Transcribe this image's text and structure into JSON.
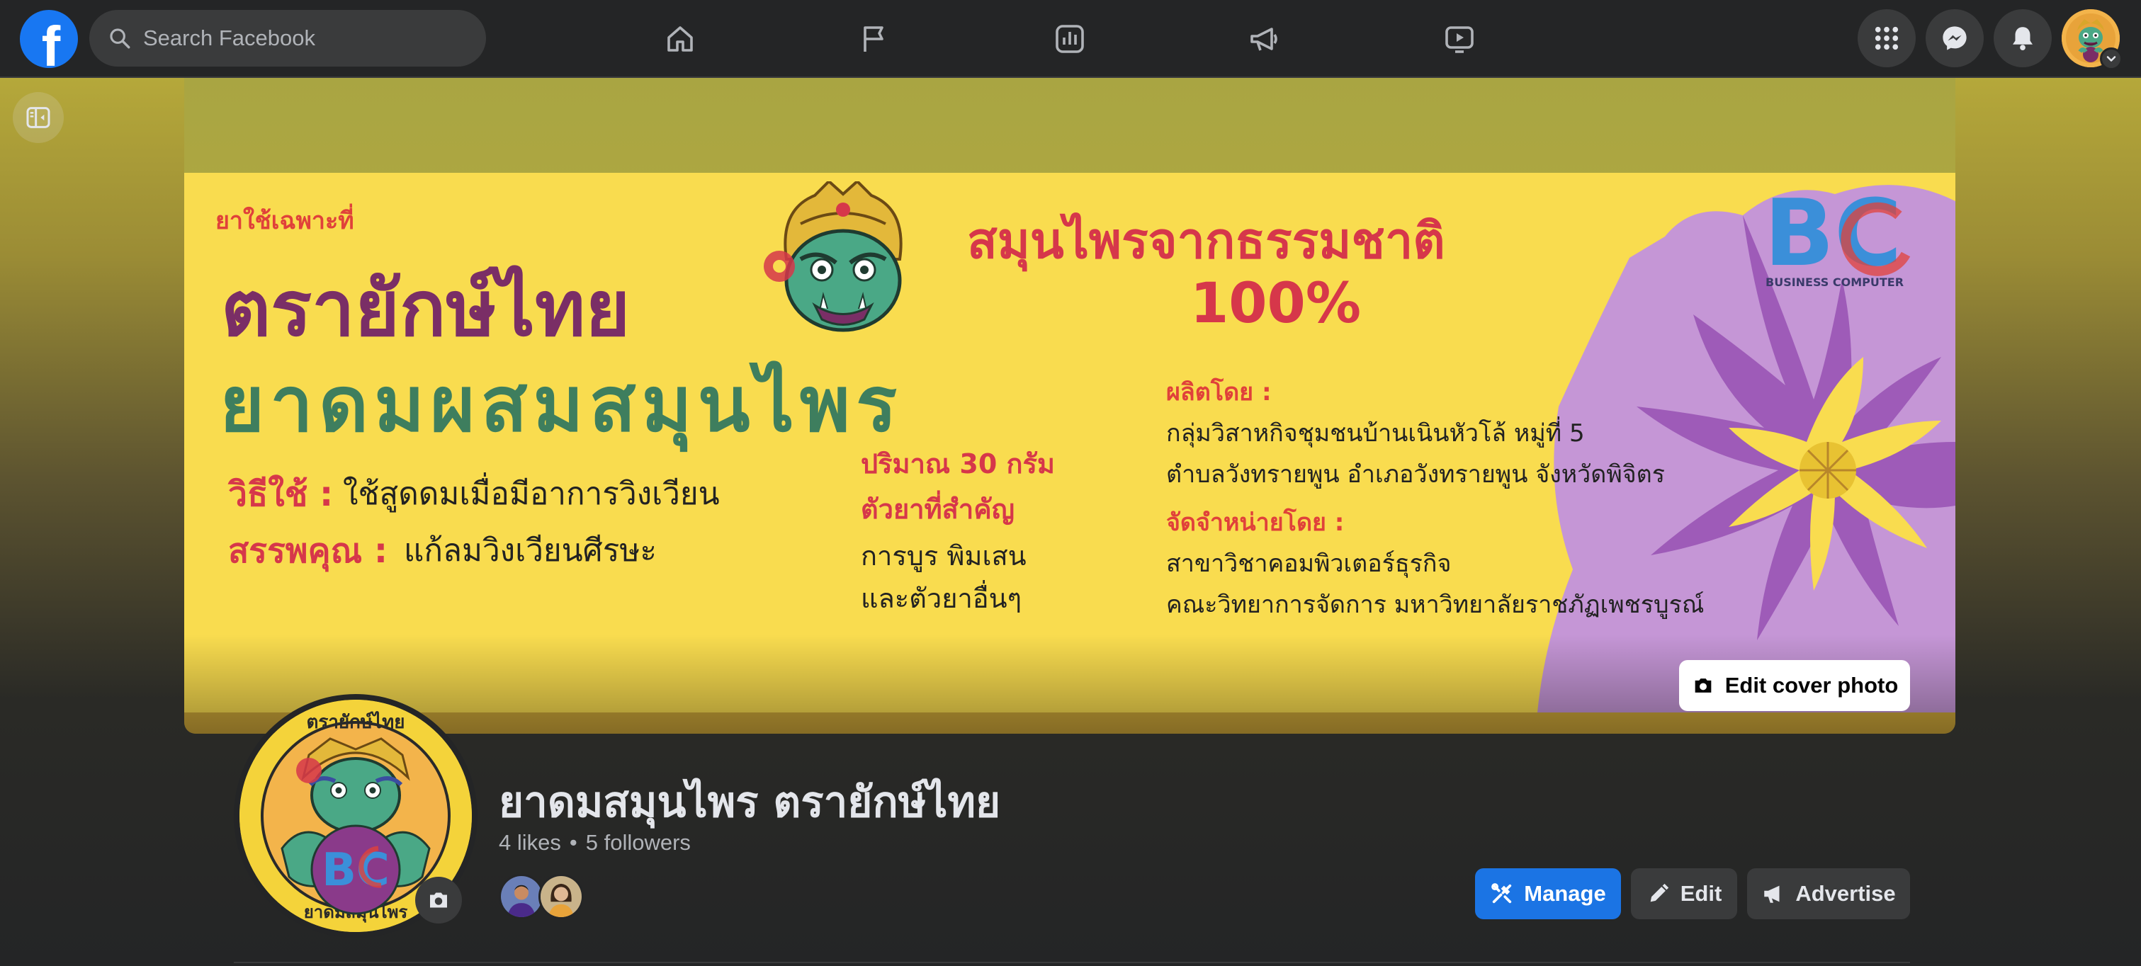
{
  "topbar": {
    "search_placeholder": "Search Facebook",
    "nav_icons": [
      "home-icon",
      "flag-icon",
      "insights-icon",
      "megaphone-icon",
      "video-icon"
    ],
    "right_icons": [
      "menu-grid-icon",
      "messenger-icon",
      "bell-icon"
    ]
  },
  "cover": {
    "edit_cover_label": "Edit cover photo",
    "banner": {
      "small_note": "ยาใช้เฉพาะที่",
      "brand": "ตรายักษ์ไทย",
      "product": "ยาดมผสมสมุนไพร",
      "headline": "สมุนไพรจากธรรมชาติ",
      "percent": "100%",
      "usage_label": "วิธีใช้ :",
      "usage_text": "ใช้สูดดมเมื่อมีอาการวิงเวียน",
      "benefit_label": "สรรพคุณ :",
      "benefit_text": "แก้ลมวิงเวียนศีรษะ",
      "quantity": "ปริมาณ  30  กรัม",
      "ingredients_label": "ตัวยาที่สำคัญ",
      "ingredients_line1": "การบูร  พิมเสน",
      "ingredients_line2": "และตัวยาอื่นๆ",
      "producer_label": "ผลิตโดย :",
      "producer_line1": "กลุ่มวิสาหกิจชุมชนบ้านเนินหัวโล้  หมู่ที่  5",
      "producer_line2": "ตำบลวังทรายพูน  อำเภอวังทรายพูน  จังหวัดพิจิตร",
      "distributor_label": "จัดจำหน่ายโดย :",
      "distributor_line1": "สาขาวิชาคอมพิวเตอร์ธุรกิจ",
      "distributor_line2": "คณะวิทยาการจัดการ  มหาวิทยาลัยราชภัฏเพชรบูรณ์",
      "logo_text": "BC",
      "logo_caption": "BUSINESS COMPUTER"
    }
  },
  "profile": {
    "badge_top": "ตรายักษ์ไทย",
    "badge_bottom": "ยาดมสมุนไพร",
    "badge_center": "BC",
    "page_name": "ยาดมสมุนไพร ตรายักษ์ไทย",
    "likes": "4 likes",
    "separator": "•",
    "followers": "5 followers"
  },
  "actions": {
    "manage": "Manage",
    "edit": "Edit",
    "advertise": "Advertise"
  },
  "colors": {
    "accent": "#1b74e4",
    "banner_yellow": "#f9dc4f",
    "brand_purple": "#7a2e66",
    "herbal_green": "#3e7e5e",
    "headline_red": "#d6374a"
  }
}
